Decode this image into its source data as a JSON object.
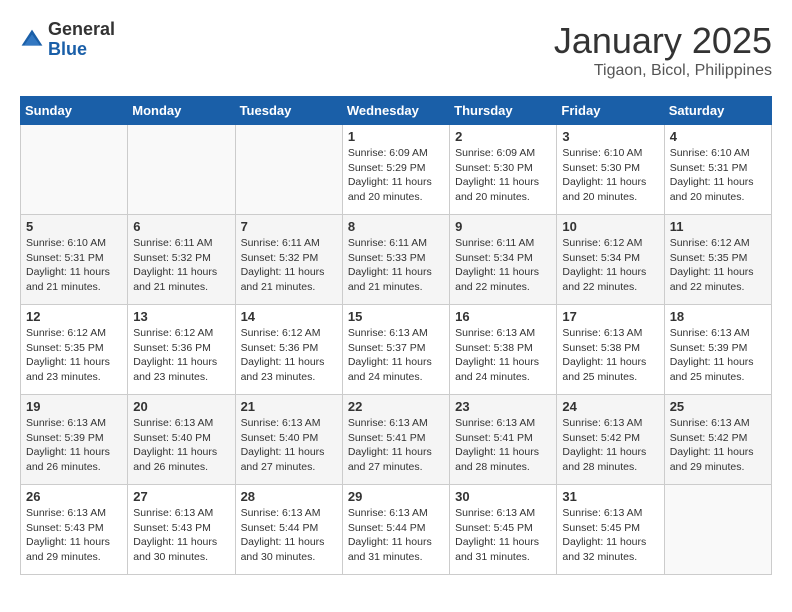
{
  "logo": {
    "general": "General",
    "blue": "Blue"
  },
  "header": {
    "title": "January 2025",
    "subtitle": "Tigaon, Bicol, Philippines"
  },
  "weekdays": [
    "Sunday",
    "Monday",
    "Tuesday",
    "Wednesday",
    "Thursday",
    "Friday",
    "Saturday"
  ],
  "weeks": [
    [
      {
        "day": "",
        "info": ""
      },
      {
        "day": "",
        "info": ""
      },
      {
        "day": "",
        "info": ""
      },
      {
        "day": "1",
        "info": "Sunrise: 6:09 AM\nSunset: 5:29 PM\nDaylight: 11 hours and 20 minutes."
      },
      {
        "day": "2",
        "info": "Sunrise: 6:09 AM\nSunset: 5:30 PM\nDaylight: 11 hours and 20 minutes."
      },
      {
        "day": "3",
        "info": "Sunrise: 6:10 AM\nSunset: 5:30 PM\nDaylight: 11 hours and 20 minutes."
      },
      {
        "day": "4",
        "info": "Sunrise: 6:10 AM\nSunset: 5:31 PM\nDaylight: 11 hours and 20 minutes."
      }
    ],
    [
      {
        "day": "5",
        "info": "Sunrise: 6:10 AM\nSunset: 5:31 PM\nDaylight: 11 hours and 21 minutes."
      },
      {
        "day": "6",
        "info": "Sunrise: 6:11 AM\nSunset: 5:32 PM\nDaylight: 11 hours and 21 minutes."
      },
      {
        "day": "7",
        "info": "Sunrise: 6:11 AM\nSunset: 5:32 PM\nDaylight: 11 hours and 21 minutes."
      },
      {
        "day": "8",
        "info": "Sunrise: 6:11 AM\nSunset: 5:33 PM\nDaylight: 11 hours and 21 minutes."
      },
      {
        "day": "9",
        "info": "Sunrise: 6:11 AM\nSunset: 5:34 PM\nDaylight: 11 hours and 22 minutes."
      },
      {
        "day": "10",
        "info": "Sunrise: 6:12 AM\nSunset: 5:34 PM\nDaylight: 11 hours and 22 minutes."
      },
      {
        "day": "11",
        "info": "Sunrise: 6:12 AM\nSunset: 5:35 PM\nDaylight: 11 hours and 22 minutes."
      }
    ],
    [
      {
        "day": "12",
        "info": "Sunrise: 6:12 AM\nSunset: 5:35 PM\nDaylight: 11 hours and 23 minutes."
      },
      {
        "day": "13",
        "info": "Sunrise: 6:12 AM\nSunset: 5:36 PM\nDaylight: 11 hours and 23 minutes."
      },
      {
        "day": "14",
        "info": "Sunrise: 6:12 AM\nSunset: 5:36 PM\nDaylight: 11 hours and 23 minutes."
      },
      {
        "day": "15",
        "info": "Sunrise: 6:13 AM\nSunset: 5:37 PM\nDaylight: 11 hours and 24 minutes."
      },
      {
        "day": "16",
        "info": "Sunrise: 6:13 AM\nSunset: 5:38 PM\nDaylight: 11 hours and 24 minutes."
      },
      {
        "day": "17",
        "info": "Sunrise: 6:13 AM\nSunset: 5:38 PM\nDaylight: 11 hours and 25 minutes."
      },
      {
        "day": "18",
        "info": "Sunrise: 6:13 AM\nSunset: 5:39 PM\nDaylight: 11 hours and 25 minutes."
      }
    ],
    [
      {
        "day": "19",
        "info": "Sunrise: 6:13 AM\nSunset: 5:39 PM\nDaylight: 11 hours and 26 minutes."
      },
      {
        "day": "20",
        "info": "Sunrise: 6:13 AM\nSunset: 5:40 PM\nDaylight: 11 hours and 26 minutes."
      },
      {
        "day": "21",
        "info": "Sunrise: 6:13 AM\nSunset: 5:40 PM\nDaylight: 11 hours and 27 minutes."
      },
      {
        "day": "22",
        "info": "Sunrise: 6:13 AM\nSunset: 5:41 PM\nDaylight: 11 hours and 27 minutes."
      },
      {
        "day": "23",
        "info": "Sunrise: 6:13 AM\nSunset: 5:41 PM\nDaylight: 11 hours and 28 minutes."
      },
      {
        "day": "24",
        "info": "Sunrise: 6:13 AM\nSunset: 5:42 PM\nDaylight: 11 hours and 28 minutes."
      },
      {
        "day": "25",
        "info": "Sunrise: 6:13 AM\nSunset: 5:42 PM\nDaylight: 11 hours and 29 minutes."
      }
    ],
    [
      {
        "day": "26",
        "info": "Sunrise: 6:13 AM\nSunset: 5:43 PM\nDaylight: 11 hours and 29 minutes."
      },
      {
        "day": "27",
        "info": "Sunrise: 6:13 AM\nSunset: 5:43 PM\nDaylight: 11 hours and 30 minutes."
      },
      {
        "day": "28",
        "info": "Sunrise: 6:13 AM\nSunset: 5:44 PM\nDaylight: 11 hours and 30 minutes."
      },
      {
        "day": "29",
        "info": "Sunrise: 6:13 AM\nSunset: 5:44 PM\nDaylight: 11 hours and 31 minutes."
      },
      {
        "day": "30",
        "info": "Sunrise: 6:13 AM\nSunset: 5:45 PM\nDaylight: 11 hours and 31 minutes."
      },
      {
        "day": "31",
        "info": "Sunrise: 6:13 AM\nSunset: 5:45 PM\nDaylight: 11 hours and 32 minutes."
      },
      {
        "day": "",
        "info": ""
      }
    ]
  ]
}
